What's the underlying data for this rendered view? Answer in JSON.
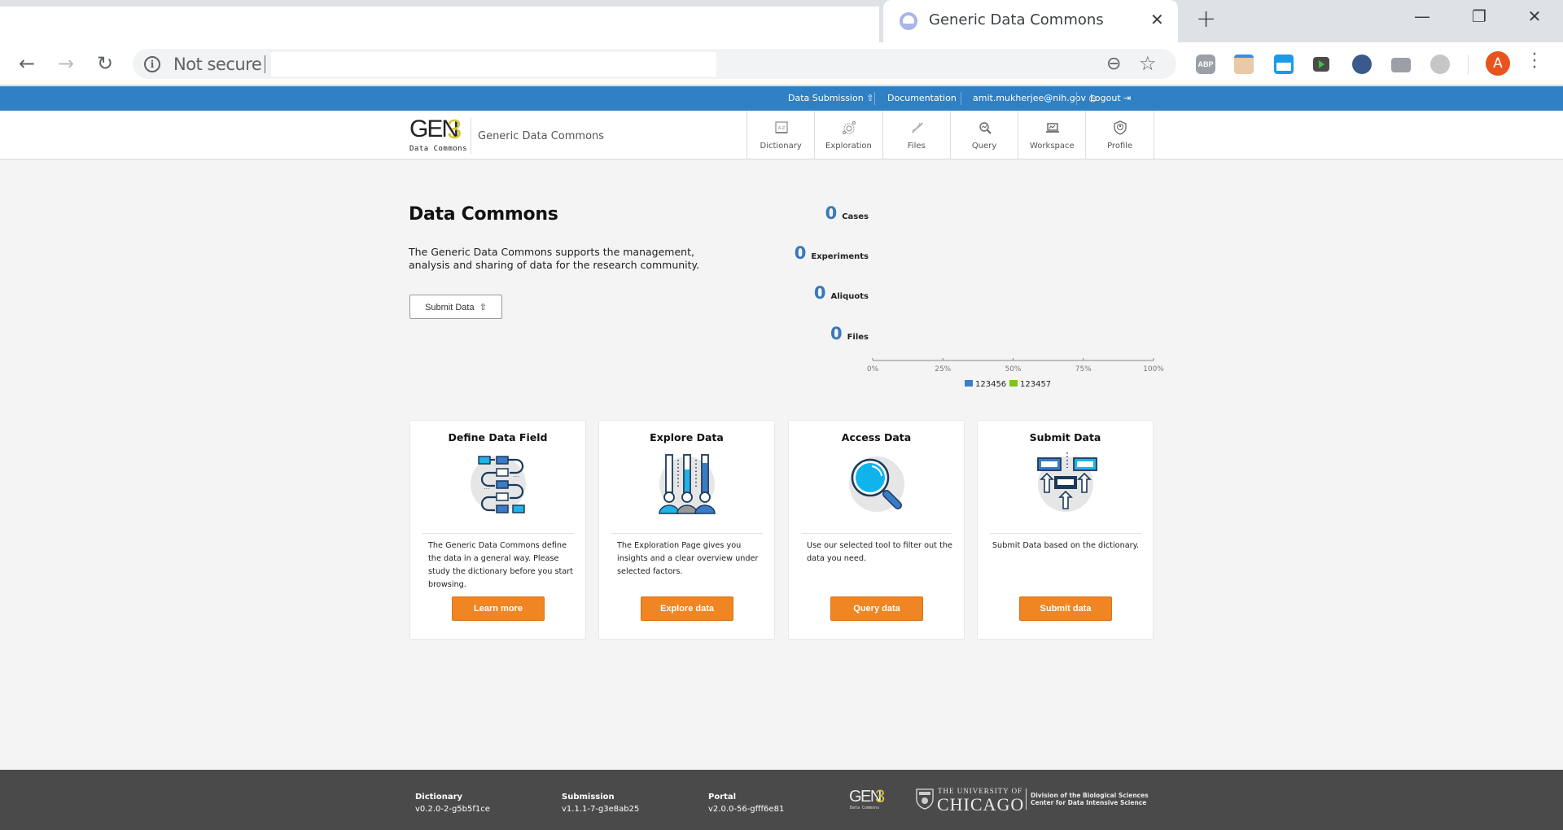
{
  "browser": {
    "tab_title": "Generic Data Commons",
    "tab_close": "✕",
    "new_tab": "+",
    "window_controls": {
      "minimize": "—",
      "restore": "❐",
      "close": "✕"
    },
    "nav": {
      "back": "←",
      "forward": "→",
      "reload": "↻"
    },
    "security_label": "Not secure",
    "url_value": "",
    "icons": [
      "zoom-out-icon",
      "star-icon",
      "adblock-plus-extension-icon",
      "clipboard-extension-icon",
      "folder-extension-icon",
      "cast-extension-icon",
      "phone-extension-icon",
      "camera-extension-icon",
      "circle-extension-icon",
      "profile-avatar",
      "menu-icon"
    ],
    "avatar_letter": "A",
    "avatar_color": "#e8541e"
  },
  "topbar": {
    "color": "#2f80c4",
    "links": [
      {
        "label": "Data Submission",
        "icon": "upload-icon"
      },
      {
        "label": "Documentation"
      },
      {
        "label": "amit.mukherjee@nih.gov",
        "icon": "user-icon"
      },
      {
        "label": "Logout",
        "icon": "logout-icon"
      }
    ]
  },
  "header": {
    "logo": {
      "text": "GEN",
      "number": "3",
      "subtitle": "Data Commons"
    },
    "site_title": "Generic Data Commons",
    "nav": [
      {
        "label": "Dictionary",
        "icon": "dictionary-icon"
      },
      {
        "label": "Exploration",
        "icon": "exploration-icon"
      },
      {
        "label": "Files",
        "icon": "dna-icon"
      },
      {
        "label": "Query",
        "icon": "query-icon"
      },
      {
        "label": "Workspace",
        "icon": "workspace-icon"
      },
      {
        "label": "Profile",
        "icon": "profile-shield-icon"
      }
    ]
  },
  "intro": {
    "title": "Data Commons",
    "description": "The Generic Data Commons supports the management, analysis and sharing of data for the research community.",
    "submit_button": "Submit Data",
    "submit_icon": "⇧"
  },
  "stats": [
    {
      "value": "0",
      "label": "Cases"
    },
    {
      "value": "0",
      "label": "Experiments"
    },
    {
      "value": "0",
      "label": "Aliquots"
    },
    {
      "value": "0",
      "label": "Files"
    }
  ],
  "chart_data": {
    "type": "bar",
    "orientation": "horizontal-stacked",
    "categories": [
      "Cases",
      "Experiments",
      "Aliquots",
      "Files"
    ],
    "series": [
      {
        "name": "123456",
        "color": "#3a80c8",
        "values": [
          0,
          0,
          0,
          0
        ]
      },
      {
        "name": "123457",
        "color": "#7fc41c",
        "values": [
          0,
          0,
          0,
          0
        ]
      }
    ],
    "xlim": [
      0,
      100
    ],
    "x_ticks": [
      "0%",
      "25%",
      "50%",
      "75%",
      "100%"
    ],
    "legend": "bottom",
    "title": "",
    "xlabel": "",
    "ylabel": ""
  },
  "cards": [
    {
      "title": "Define Data Field",
      "icon": "data-flow-icon",
      "description": "The Generic Data Commons define the data in a general way. Please study the dictionary before you start browsing.",
      "button": "Learn more"
    },
    {
      "title": "Explore Data",
      "icon": "explore-people-icon",
      "description": "The Exploration Page gives you insights and a clear overview under selected factors.",
      "button": "Explore data"
    },
    {
      "title": "Access Data",
      "icon": "magnifier-icon",
      "description": "Use our selected tool to filter out the data you need.",
      "button": "Query data"
    },
    {
      "title": "Submit Data",
      "icon": "upload-arrows-icon",
      "description": "Submit Data based on the dictionary.",
      "button": "Submit data"
    }
  ],
  "accent_color": "#ef8523",
  "footer": {
    "columns": [
      {
        "label": "Dictionary",
        "value": "v0.2.0-2-g5b5f1ce"
      },
      {
        "label": "Submission",
        "value": "v1.1.1-7-g3e8ab25"
      },
      {
        "label": "Portal",
        "value": "v2.0.0-56-gfff6e81"
      }
    ],
    "gen3_logo": {
      "text": "GEN",
      "number": "3",
      "subtitle": "Data Commons"
    },
    "uchicago": {
      "line1": "THE UNIVERSITY OF",
      "line2": "CHICAGO",
      "division1": "Division of the Biological Sciences",
      "division2": "Center for Data Intensive Science"
    }
  }
}
